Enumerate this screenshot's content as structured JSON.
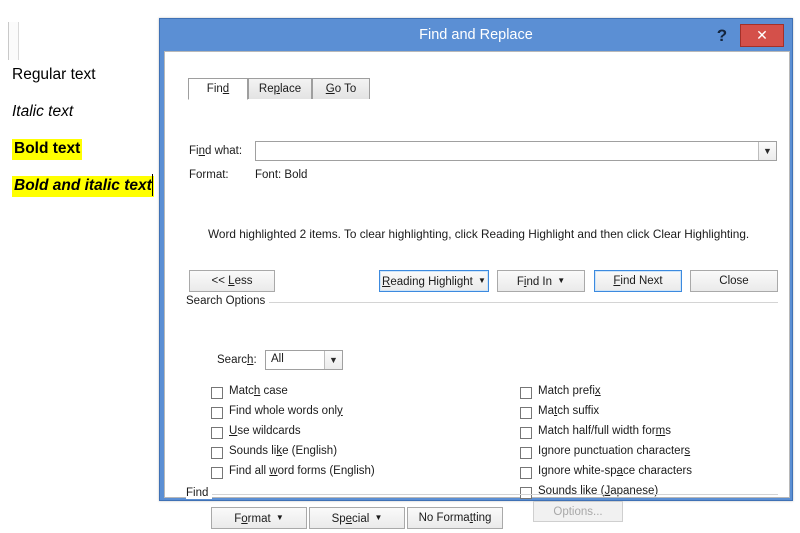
{
  "document_background": {
    "lines": [
      {
        "text": "Regular text",
        "style": "regular",
        "highlight": false
      },
      {
        "text": "Italic text",
        "style": "italic",
        "highlight": false
      },
      {
        "text": "Bold text",
        "style": "bold",
        "highlight": true
      },
      {
        "text": "Bold and italic text",
        "style": "bold-italic",
        "highlight": true
      }
    ],
    "highlight_color": "#ffff00"
  },
  "dialog": {
    "title": "Find and Replace",
    "titlebar_color": "#5b8fd4",
    "help_icon": "?",
    "close_icon": "✕",
    "close_color": "#d4504a",
    "tabs": [
      {
        "label": "Find",
        "accel": "d",
        "active": true
      },
      {
        "label": "Replace",
        "accel": "p",
        "active": false
      },
      {
        "label": "Go To",
        "accel": "G",
        "active": false
      }
    ],
    "find_what": {
      "label": "Find what:",
      "accel": "n",
      "value": "",
      "placeholder": "",
      "dropdown_icon": "chevron-down"
    },
    "format": {
      "label": "Format:",
      "value": "Font: Bold"
    },
    "status_message": "Word highlighted 2 items. To clear highlighting, click Reading Highlight and then click Clear Highlighting.",
    "buttons": {
      "less": {
        "label": "<< Less",
        "accel": "L",
        "focused": false
      },
      "reading_highlight": {
        "label": "Reading Highlight",
        "accel": "R",
        "has_dropdown": true,
        "focused": true
      },
      "find_in": {
        "label": "Find In",
        "accel": "i",
        "has_dropdown": true,
        "focused": false
      },
      "find_next": {
        "label": "Find Next",
        "accel": "F",
        "focused": true
      },
      "close": {
        "label": "Close",
        "accel": "",
        "focused": false
      }
    },
    "search_options": {
      "legend": "Search Options",
      "search_label": "Search:",
      "search_accel": "h",
      "search_value": "All",
      "search_dropdown_icon": "chevron-down",
      "left_checkboxes": [
        {
          "label": "Match case",
          "accel": "h",
          "checked": false
        },
        {
          "label": "Find whole words only",
          "accel": "y",
          "checked": false
        },
        {
          "label": "Use wildcards",
          "accel": "U",
          "checked": false
        },
        {
          "label": "Sounds like (English)",
          "accel": "k",
          "checked": false
        },
        {
          "label": "Find all word forms (English)",
          "accel": "w",
          "checked": false
        }
      ],
      "right_checkboxes": [
        {
          "label": "Match prefix",
          "accel": "x",
          "checked": false
        },
        {
          "label": "Match suffix",
          "accel": "t",
          "checked": false
        },
        {
          "label": "Match half/full width forms",
          "accel": "m",
          "checked": false
        },
        {
          "label": "Ignore punctuation characters",
          "accel": "s",
          "checked": false
        },
        {
          "label": "Ignore white-space characters",
          "accel": "a",
          "checked": false
        },
        {
          "label": "Sounds like (Japanese)",
          "accel": "J",
          "checked": false
        }
      ],
      "options_button": {
        "label": "Options...",
        "disabled": true
      }
    },
    "find_group": {
      "legend": "Find",
      "format_button": {
        "label": "Format",
        "accel": "o",
        "has_dropdown": true
      },
      "special_button": {
        "label": "Special",
        "accel": "e",
        "has_dropdown": true
      },
      "no_formatting_button": {
        "label": "No Formatting",
        "accel": "t"
      }
    }
  }
}
